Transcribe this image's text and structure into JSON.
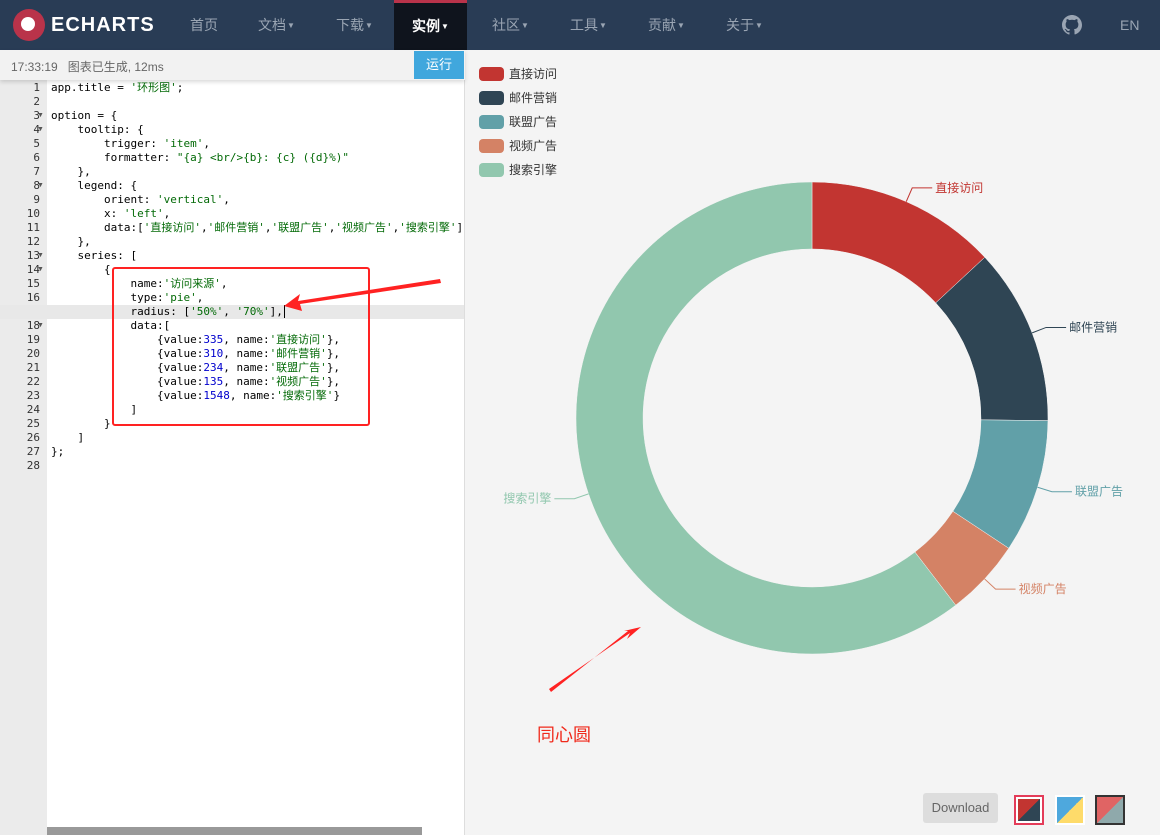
{
  "nav": {
    "logo": "ECHARTS",
    "items": [
      {
        "label": "首页",
        "caret": false
      },
      {
        "label": "文档",
        "caret": true
      },
      {
        "label": "下载",
        "caret": true
      },
      {
        "label": "实例",
        "caret": true,
        "active": true
      },
      {
        "label": "社区",
        "caret": true
      },
      {
        "label": "工具",
        "caret": true
      },
      {
        "label": "贡献",
        "caret": true
      },
      {
        "label": "关于",
        "caret": true
      }
    ],
    "lang": "EN"
  },
  "toolbar": {
    "status": "17:33:19   图表已生成, 12ms",
    "run": "运行"
  },
  "editor": {
    "lines": [
      [
        [
          "p",
          "app.title = "
        ],
        [
          "s",
          "'环形图'"
        ],
        [
          "p",
          ";"
        ]
      ],
      [],
      [
        [
          "p",
          "option = {"
        ]
      ],
      [
        [
          "p",
          "    tooltip: {"
        ]
      ],
      [
        [
          "p",
          "        trigger: "
        ],
        [
          "s",
          "'item'"
        ],
        [
          "p",
          ","
        ]
      ],
      [
        [
          "p",
          "        formatter: "
        ],
        [
          "s",
          "\"{a} <br/>{b}: {c} ({d}%)\""
        ]
      ],
      [
        [
          "p",
          "    },"
        ]
      ],
      [
        [
          "p",
          "    legend: {"
        ]
      ],
      [
        [
          "p",
          "        orient: "
        ],
        [
          "s",
          "'vertical'"
        ],
        [
          "p",
          ","
        ]
      ],
      [
        [
          "p",
          "        x: "
        ],
        [
          "s",
          "'left'"
        ],
        [
          "p",
          ","
        ]
      ],
      [
        [
          "p",
          "        data:["
        ],
        [
          "s",
          "'直接访问'"
        ],
        [
          "p",
          ","
        ],
        [
          "s",
          "'邮件营销'"
        ],
        [
          "p",
          ","
        ],
        [
          "s",
          "'联盟广告'"
        ],
        [
          "p",
          ","
        ],
        [
          "s",
          "'视频广告'"
        ],
        [
          "p",
          ","
        ],
        [
          "s",
          "'搜索引擎'"
        ],
        [
          "p",
          "]"
        ]
      ],
      [
        [
          "p",
          "    },"
        ]
      ],
      [
        [
          "p",
          "    series: ["
        ]
      ],
      [
        [
          "p",
          "        {"
        ]
      ],
      [
        [
          "p",
          "            name:"
        ],
        [
          "s",
          "'访问来源'"
        ],
        [
          "p",
          ","
        ]
      ],
      [
        [
          "p",
          "            type:"
        ],
        [
          "s",
          "'pie'"
        ],
        [
          "p",
          ","
        ]
      ],
      [
        [
          "p",
          "            radius: ["
        ],
        [
          "s",
          "'50%'"
        ],
        [
          "p",
          ", "
        ],
        [
          "s",
          "'70%'"
        ],
        [
          "p",
          "],"
        ]
      ],
      [
        [
          "p",
          "            data:["
        ]
      ],
      [
        [
          "p",
          "                {value:"
        ],
        [
          "n",
          "335"
        ],
        [
          "p",
          ", name:"
        ],
        [
          "s",
          "'直接访问'"
        ],
        [
          "p",
          "},"
        ]
      ],
      [
        [
          "p",
          "                {value:"
        ],
        [
          "n",
          "310"
        ],
        [
          "p",
          ", name:"
        ],
        [
          "s",
          "'邮件营销'"
        ],
        [
          "p",
          "},"
        ]
      ],
      [
        [
          "p",
          "                {value:"
        ],
        [
          "n",
          "234"
        ],
        [
          "p",
          ", name:"
        ],
        [
          "s",
          "'联盟广告'"
        ],
        [
          "p",
          "},"
        ]
      ],
      [
        [
          "p",
          "                {value:"
        ],
        [
          "n",
          "135"
        ],
        [
          "p",
          ", name:"
        ],
        [
          "s",
          "'视频广告'"
        ],
        [
          "p",
          "},"
        ]
      ],
      [
        [
          "p",
          "                {value:"
        ],
        [
          "n",
          "1548"
        ],
        [
          "p",
          ", name:"
        ],
        [
          "s",
          "'搜索引擎'"
        ],
        [
          "p",
          "}"
        ]
      ],
      [
        [
          "p",
          "            ]"
        ]
      ],
      [
        [
          "p",
          "        }"
        ]
      ],
      [
        [
          "p",
          "    ]"
        ]
      ],
      [
        [
          "p",
          "};"
        ]
      ],
      []
    ],
    "fold_lines": [
      3,
      4,
      8,
      13,
      14,
      18
    ],
    "active_line": 17
  },
  "annotation": {
    "text": "同心圆",
    "color": "#f02a1c"
  },
  "chart_data": {
    "type": "pie",
    "series_name": "访问来源",
    "radius": [
      "50%",
      "70%"
    ],
    "categories": [
      "直接访问",
      "邮件营销",
      "联盟广告",
      "视频广告",
      "搜索引擎"
    ],
    "values": [
      335,
      310,
      234,
      135,
      1548
    ],
    "colors": [
      "#c23531",
      "#2f4554",
      "#61a0a8",
      "#d48265",
      "#91c7ae"
    ],
    "legend": {
      "orient": "vertical",
      "placement": "top-left"
    }
  },
  "footer": {
    "download": "Download"
  }
}
